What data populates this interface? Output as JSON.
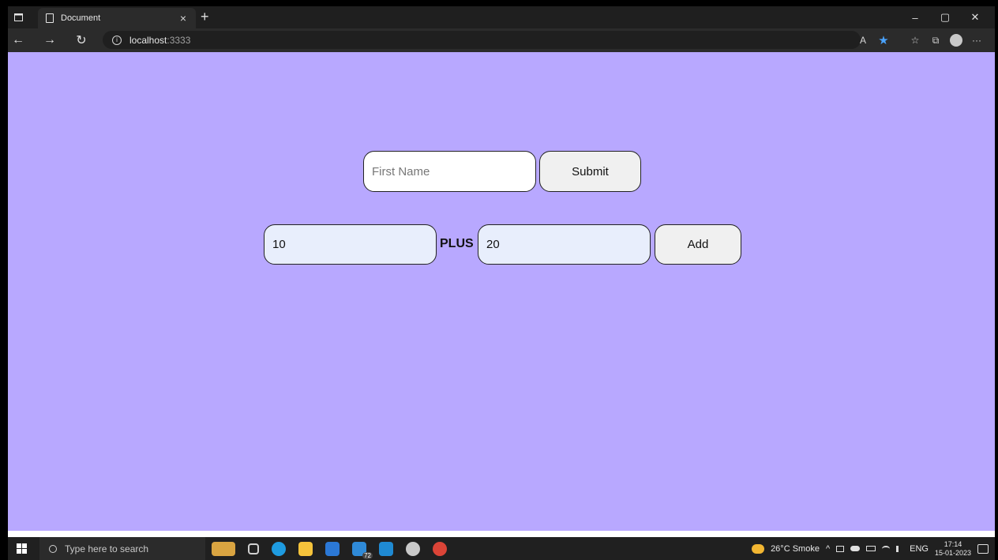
{
  "browser": {
    "tab_title": "Document",
    "tab_close": "×",
    "new_tab": "+",
    "controls": {
      "minimize": "–",
      "restore": "▢",
      "close": "✕"
    },
    "nav": {
      "back": "←",
      "forward": "→",
      "refresh": "↻"
    },
    "url_host": "localhost",
    "url_port": ":3333",
    "toolbar": {
      "read_aloud": "A",
      "favorite_star": "★",
      "favorites": "☆",
      "collections": "⧉",
      "more": "···"
    }
  },
  "form": {
    "first_name_placeholder": "First Name",
    "submit_label": "Submit",
    "num1_value": "10",
    "plus_label": "PLUS",
    "num2_value": "20",
    "add_label": "Add"
  },
  "taskbar": {
    "search_placeholder": "Type here to search",
    "weather": "26°C Smoke",
    "language": "ENG",
    "time": "17:14",
    "date": "15-01-2023",
    "mail_badge": "72",
    "tray_chevron": "^"
  },
  "colors": {
    "page_background": "#b8a8ff",
    "number_input_background": "#e8eefc",
    "button_background": "#f0f0f0"
  }
}
